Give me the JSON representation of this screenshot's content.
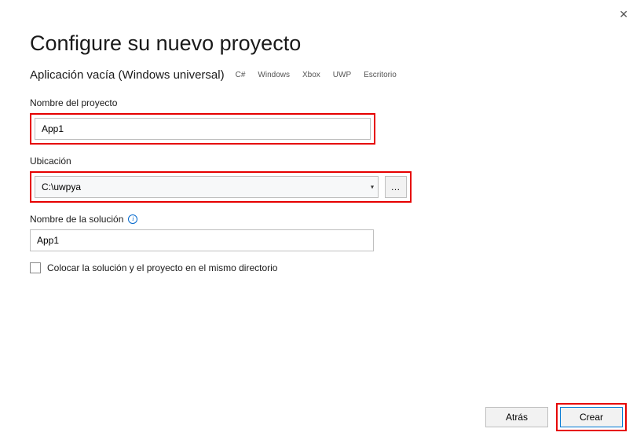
{
  "window": {
    "close": "✕"
  },
  "header": {
    "title": "Configure su nuevo proyecto",
    "subtitle": "Aplicación vacía (Windows universal)",
    "tags": [
      "C#",
      "Windows",
      "Xbox",
      "UWP",
      "Escritorio"
    ]
  },
  "fields": {
    "projectName": {
      "label": "Nombre del proyecto",
      "value": "App1"
    },
    "location": {
      "label": "Ubicación",
      "value": "C:\\uwpya",
      "browse": "…"
    },
    "solutionName": {
      "label": "Nombre de la solución",
      "value": "App1"
    },
    "sameDirectory": {
      "label": "Colocar la solución y el proyecto en el mismo directorio",
      "checked": false
    }
  },
  "footer": {
    "back": "Atrás",
    "create": "Crear"
  }
}
